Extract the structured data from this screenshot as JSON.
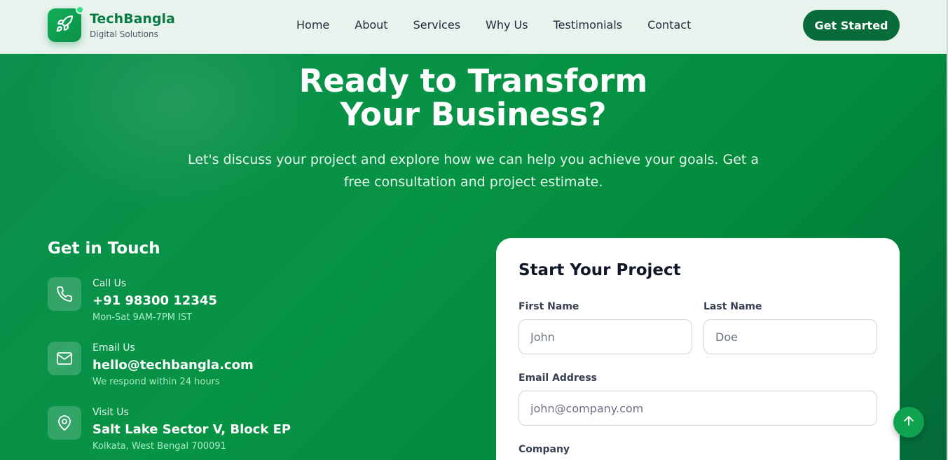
{
  "header": {
    "brand_name": "TechBangla",
    "brand_tagline": "Digital Solutions",
    "logo_icon": "rocket-icon",
    "nav": [
      {
        "label": "Home"
      },
      {
        "label": "About"
      },
      {
        "label": "Services"
      },
      {
        "label": "Why Us"
      },
      {
        "label": "Testimonials"
      },
      {
        "label": "Contact"
      }
    ],
    "cta_label": "Get Started"
  },
  "hero": {
    "title_line1": "Ready to Transform",
    "title_line2": "Your Business?",
    "subtitle_line1": "Let's discuss your project and explore how we can help you achieve your goals. Get a",
    "subtitle_line2": "free consultation and project estimate."
  },
  "contact": {
    "title": "Get in Touch",
    "items": [
      {
        "icon": "phone-icon",
        "label": "Call Us",
        "value": "+91 98300 12345",
        "note": "Mon-Sat 9AM-7PM IST"
      },
      {
        "icon": "mail-icon",
        "label": "Email Us",
        "value": "hello@techbangla.com",
        "note": "We respond within 24 hours"
      },
      {
        "icon": "location-pin-icon",
        "label": "Visit Us",
        "value": "Salt Lake Sector V, Block EP",
        "note": "Kolkata, West Bengal 700091"
      }
    ]
  },
  "form": {
    "title": "Start Your Project",
    "first_name_label": "First Name",
    "first_name_placeholder": "John",
    "last_name_label": "Last Name",
    "last_name_placeholder": "Doe",
    "email_label": "Email Address",
    "email_placeholder": "john@company.com",
    "company_label": "Company"
  },
  "colors": {
    "brand_green": "#087a42",
    "cta_green": "#086b3a",
    "hero_gradient_start": "#0c8f4e",
    "hero_gradient_end": "#046a3a",
    "scroll_button": "#0fa24f"
  },
  "scroll_top_icon": "arrow-up-icon"
}
